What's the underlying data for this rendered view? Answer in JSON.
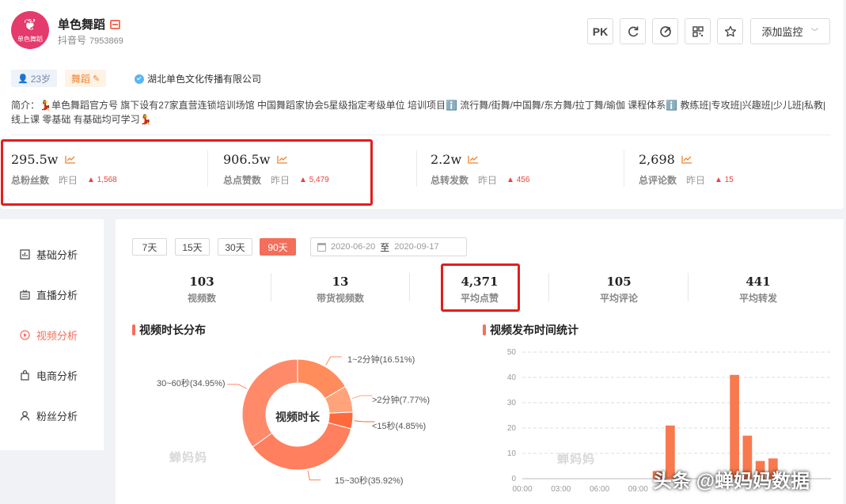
{
  "profile": {
    "name": "单色舞蹈",
    "avatar_text": "单色舞蹈",
    "douyin_label": "抖音号",
    "douyin_id": "7953869",
    "age_tag": "23岁",
    "category_tag": "舞蹈",
    "company": "湖北单色文化传播有限公司",
    "description": "简介：💃单色舞蹈官方号 旗下设有27家直营连锁培训场馆 中国舞蹈家协会5星级指定考级单位 培训项目ℹ️ 流行舞/街舞/中国舞/东方舞/拉丁舞/瑜伽 课程体系ℹ️ 教练班|专攻班|兴趣班|少儿班|私教|线上课 零基础 有基础均可学习💃"
  },
  "toolbar": {
    "pk_label": "PK",
    "monitor_label": "添加监控"
  },
  "stats": [
    {
      "value": "295.5w",
      "label": "总粉丝数",
      "yesterday": "昨日",
      "delta": "1,568"
    },
    {
      "value": "906.5w",
      "label": "总点赞数",
      "yesterday": "昨日",
      "delta": "5,479"
    },
    {
      "value": "2.2w",
      "label": "总转发数",
      "yesterday": "昨日",
      "delta": "456"
    },
    {
      "value": "2,698",
      "label": "总评论数",
      "yesterday": "昨日",
      "delta": "15"
    }
  ],
  "sidebar": {
    "items": [
      {
        "label": "基础分析",
        "icon": "bar-chart-icon"
      },
      {
        "label": "直播分析",
        "icon": "tv-icon"
      },
      {
        "label": "视频分析",
        "icon": "play-icon",
        "active": true
      },
      {
        "label": "电商分析",
        "icon": "shopping-bag-icon"
      },
      {
        "label": "粉丝分析",
        "icon": "user-icon"
      }
    ]
  },
  "ranges": [
    "7天",
    "15天",
    "30天",
    "90天"
  ],
  "date_range": {
    "start": "2020-06-20",
    "to": "至",
    "end": "2020-09-17"
  },
  "kpis": [
    {
      "value": "103",
      "label": "视频数"
    },
    {
      "value": "13",
      "label": "带货视频数"
    },
    {
      "value": "4,371",
      "label": "平均点赞"
    },
    {
      "value": "105",
      "label": "平均评论"
    },
    {
      "value": "441",
      "label": "平均转发"
    }
  ],
  "sections": {
    "duration_title": "视频时长分布",
    "publish_title": "视频发布时间统计",
    "donut_center": "视频时长",
    "watermark": "蝉妈妈"
  },
  "colors": {
    "accent": "#f36f5b",
    "highlight_box": "#e51c1c"
  },
  "chart_data": [
    {
      "type": "pie",
      "title": "视频时长分布",
      "slices": [
        {
          "label": "1~2分钟(16.51%)",
          "value": 16.51,
          "color": "#ff8c5a"
        },
        {
          "label": ">2分钟(7.77%)",
          "value": 7.77,
          "color": "#ffa37a"
        },
        {
          "label": "<15秒(4.85%)",
          "value": 4.85,
          "color": "#ff6a3d"
        },
        {
          "label": "15~30秒(35.92%)",
          "value": 35.92,
          "color": "#ff7f5e"
        },
        {
          "label": "30~60秒(34.95%)",
          "value": 34.95,
          "color": "#ff8a6a"
        }
      ]
    },
    {
      "type": "bar",
      "title": "视频发布时间统计",
      "x_ticks": [
        "00:00",
        "03:00",
        "06:00",
        "09:00"
      ],
      "y_ticks": [
        0,
        10,
        20,
        30,
        40,
        50
      ],
      "ylim": [
        0,
        50
      ],
      "x": [
        10.5,
        11.5,
        16.5,
        17.5,
        18.5,
        19.5
      ],
      "values": [
        3,
        21,
        41,
        17,
        7,
        8
      ],
      "color": "#f8794e"
    }
  ],
  "overlay": "头条 @蝉妈妈数据"
}
